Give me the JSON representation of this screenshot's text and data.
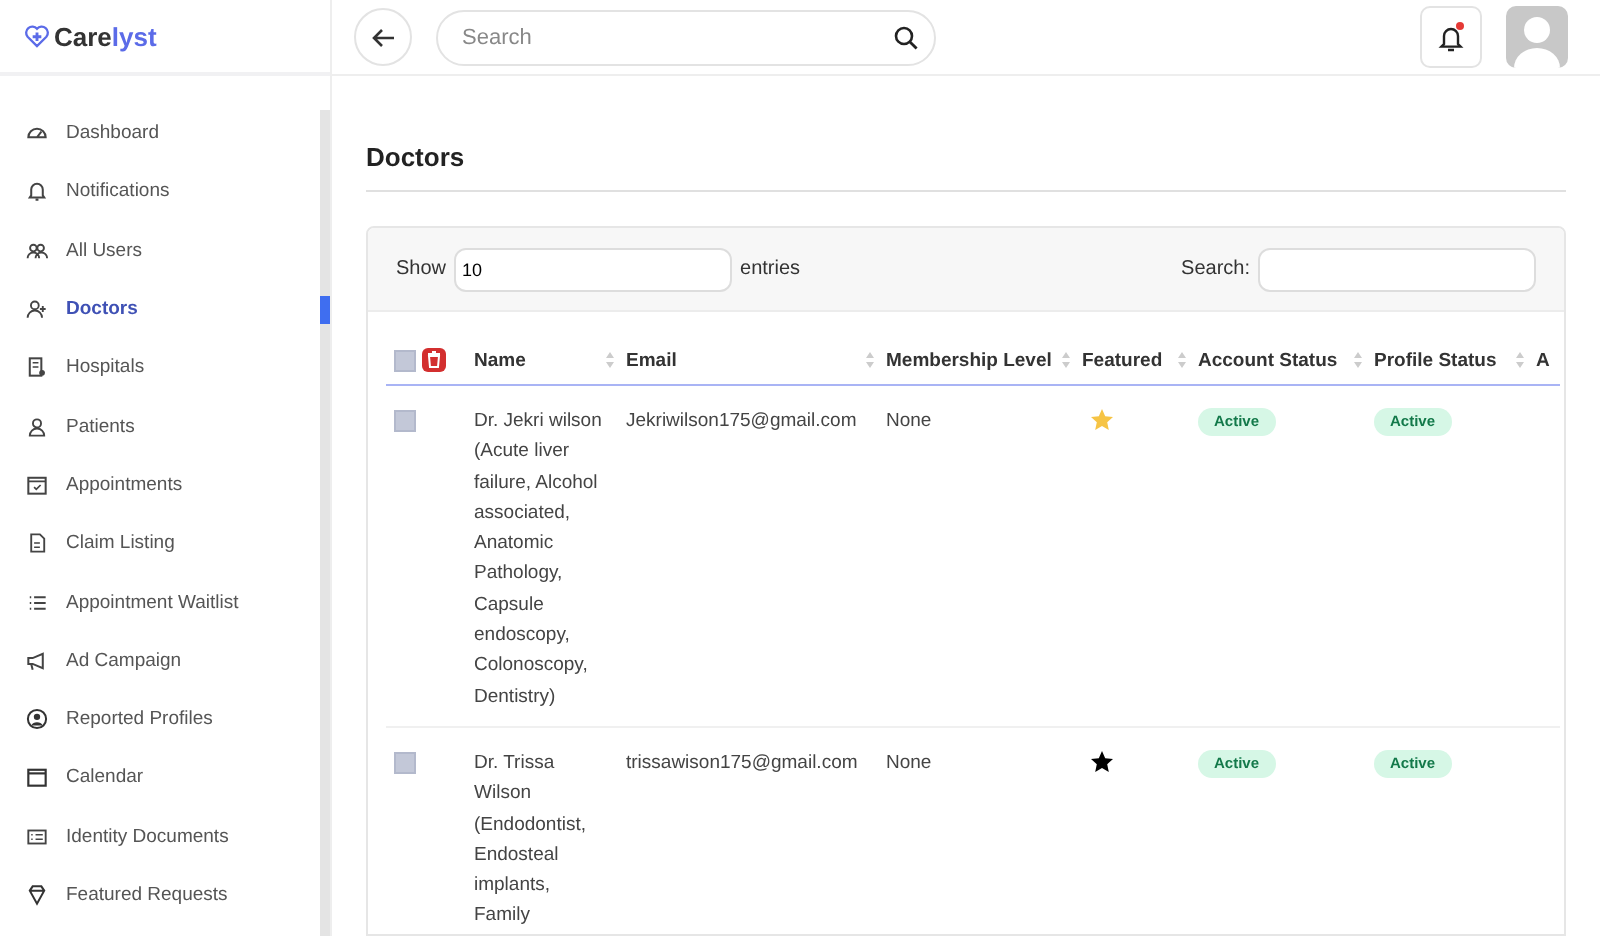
{
  "brand": {
    "name_part1": "Care",
    "name_part2": "lyst"
  },
  "header": {
    "search": {
      "placeholder": "Search"
    },
    "notifications": {
      "unread": true
    }
  },
  "sidebar": {
    "items": [
      {
        "label": "Dashboard",
        "selected": false
      },
      {
        "label": "Notifications",
        "selected": false
      },
      {
        "label": "All Users",
        "selected": false
      },
      {
        "label": "Doctors",
        "selected": true
      },
      {
        "label": "Hospitals",
        "selected": false
      },
      {
        "label": "Patients",
        "selected": false
      },
      {
        "label": "Appointments",
        "selected": false
      },
      {
        "label": "Claim Listing",
        "selected": false
      },
      {
        "label": "Appointment Waitlist",
        "selected": false
      },
      {
        "label": "Ad Campaign",
        "selected": false
      },
      {
        "label": "Reported Profiles",
        "selected": false
      },
      {
        "label": "Calendar",
        "selected": false
      },
      {
        "label": "Identity Documents",
        "selected": false
      },
      {
        "label": "Featured Requests",
        "selected": false
      }
    ]
  },
  "page": {
    "title": "Doctors"
  },
  "table": {
    "show_label": "Show",
    "entries_value": "10",
    "entries_label": "entries",
    "search_label": "Search:",
    "select_all": {
      "checked": false
    },
    "columns": [
      "Name",
      "Email",
      "Membership Level",
      "Featured",
      "Account Status",
      "Profile Status",
      "A"
    ],
    "rows": [
      {
        "checked": false,
        "name": "Dr. Jekri wilson (Acute liver failure, Alcohol associated, Anatomic Pathology, Capsule endoscopy, Colonoscopy, Dentistry)",
        "email": "Jekriwilson175@gmail.com",
        "membership": "None",
        "featured": true,
        "account_status": "Active",
        "profile_status": "Active"
      },
      {
        "checked": false,
        "name": "Dr. Trissa Wilson (Endodontist, Endosteal implants, Family",
        "email": "trissawison175@gmail.com",
        "membership": "None",
        "featured": false,
        "account_status": "Active",
        "profile_status": "Active"
      }
    ]
  }
}
